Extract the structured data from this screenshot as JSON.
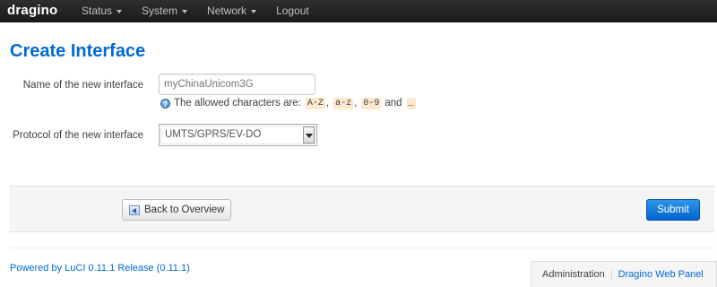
{
  "header": {
    "brand": "dragino",
    "menu": [
      {
        "label": "Status",
        "has_caret": true
      },
      {
        "label": "System",
        "has_caret": true
      },
      {
        "label": "Network",
        "has_caret": true
      },
      {
        "label": "Logout",
        "has_caret": false
      }
    ]
  },
  "page": {
    "title": "Create Interface"
  },
  "form": {
    "name_label": "Name of the new interface",
    "name_placeholder": "myChinaUnicom3G",
    "hint_prefix": "The allowed characters are:",
    "hint_tokens": [
      "A-Z",
      "a-z",
      "0-9",
      "_"
    ],
    "hint_and": "and",
    "protocol_label": "Protocol of the new interface",
    "protocol_selected": "UMTS/GPRS/EV-DO"
  },
  "actions": {
    "back_label": "Back to Overview",
    "submit_label": "Submit"
  },
  "footer": {
    "powered_by": "Powered by LuCI 0.11.1 Release (0.11.1)",
    "tab_admin": "Administration",
    "tab_separator": "|",
    "tab_panel": "Dragino Web Panel"
  },
  "colors": {
    "accent": "#0069d6",
    "topbar": "#222222",
    "code_bg": "#fee9cc"
  }
}
